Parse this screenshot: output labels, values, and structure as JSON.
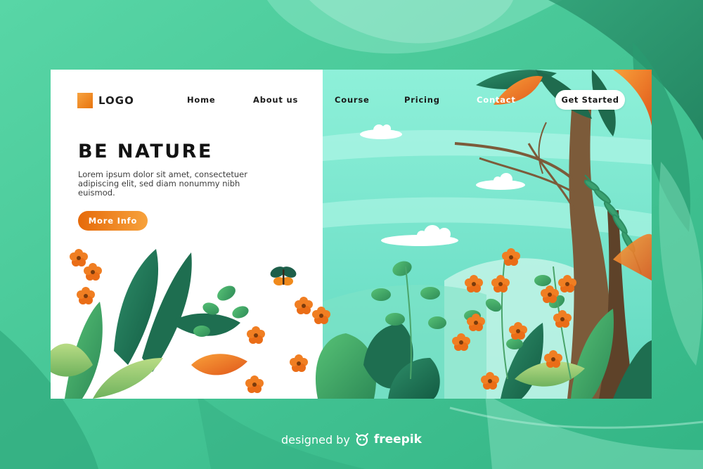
{
  "page": {
    "background_color": "#3fbf90",
    "accent_color": "#f08a1c",
    "sky_color": "#7fe6cf"
  },
  "header": {
    "logo_text": "LOGO",
    "nav": [
      {
        "label": "Home"
      },
      {
        "label": "About us"
      },
      {
        "label": "Course"
      },
      {
        "label": "Pricing"
      },
      {
        "label": "Contact"
      }
    ],
    "cta_label": "Get Started"
  },
  "hero": {
    "title": "BE NATURE",
    "body": "Lorem ipsum dolor sit amet, consectetuer adipiscing elit, sed diam nonummy nibh euismod.",
    "button_label": "More Info"
  },
  "footer": {
    "designed_by": "designed by",
    "brand": "freepik",
    "brand_icon": "freepik-logo-icon"
  }
}
